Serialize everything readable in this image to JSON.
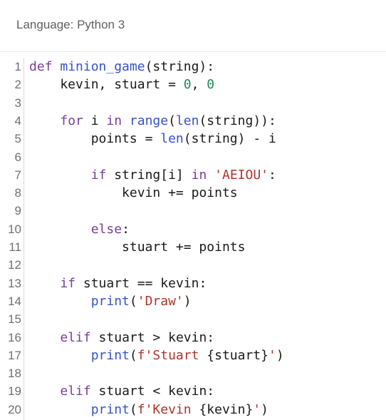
{
  "header": {
    "language_label": "Language: Python 3"
  },
  "editor": {
    "lines": [
      {
        "n": "1",
        "tokens": [
          {
            "t": "def",
            "c": "kw"
          },
          {
            "t": " ",
            "c": "txt"
          },
          {
            "t": "minion_game",
            "c": "fn"
          },
          {
            "t": "(string):",
            "c": "txt"
          }
        ]
      },
      {
        "n": "2",
        "tokens": [
          {
            "t": "    kevin, stuart ",
            "c": "txt"
          },
          {
            "t": "=",
            "c": "op"
          },
          {
            "t": " ",
            "c": "txt"
          },
          {
            "t": "0",
            "c": "num"
          },
          {
            "t": ", ",
            "c": "txt"
          },
          {
            "t": "0",
            "c": "num"
          }
        ]
      },
      {
        "n": "3",
        "tokens": []
      },
      {
        "n": "4",
        "tokens": [
          {
            "t": "    ",
            "c": "txt"
          },
          {
            "t": "for",
            "c": "kw"
          },
          {
            "t": " i ",
            "c": "txt"
          },
          {
            "t": "in",
            "c": "kw"
          },
          {
            "t": " ",
            "c": "txt"
          },
          {
            "t": "range",
            "c": "bi"
          },
          {
            "t": "(",
            "c": "txt"
          },
          {
            "t": "len",
            "c": "bi"
          },
          {
            "t": "(string)):",
            "c": "txt"
          }
        ]
      },
      {
        "n": "5",
        "tokens": [
          {
            "t": "        points ",
            "c": "txt"
          },
          {
            "t": "=",
            "c": "op"
          },
          {
            "t": " ",
            "c": "txt"
          },
          {
            "t": "len",
            "c": "bi"
          },
          {
            "t": "(string) ",
            "c": "txt"
          },
          {
            "t": "-",
            "c": "op"
          },
          {
            "t": " i",
            "c": "txt"
          }
        ]
      },
      {
        "n": "6",
        "tokens": []
      },
      {
        "n": "7",
        "tokens": [
          {
            "t": "        ",
            "c": "txt"
          },
          {
            "t": "if",
            "c": "kw"
          },
          {
            "t": " string[i] ",
            "c": "txt"
          },
          {
            "t": "in",
            "c": "kw"
          },
          {
            "t": " ",
            "c": "txt"
          },
          {
            "t": "'AEIOU'",
            "c": "str"
          },
          {
            "t": ":",
            "c": "txt"
          }
        ]
      },
      {
        "n": "8",
        "tokens": [
          {
            "t": "            kevin ",
            "c": "txt"
          },
          {
            "t": "+=",
            "c": "op"
          },
          {
            "t": " points",
            "c": "txt"
          }
        ]
      },
      {
        "n": "9",
        "tokens": []
      },
      {
        "n": "10",
        "tokens": [
          {
            "t": "        ",
            "c": "txt"
          },
          {
            "t": "else",
            "c": "kw"
          },
          {
            "t": ":",
            "c": "txt"
          }
        ]
      },
      {
        "n": "11",
        "tokens": [
          {
            "t": "            stuart ",
            "c": "txt"
          },
          {
            "t": "+=",
            "c": "op"
          },
          {
            "t": " points",
            "c": "txt"
          }
        ]
      },
      {
        "n": "12",
        "tokens": []
      },
      {
        "n": "13",
        "tokens": [
          {
            "t": "    ",
            "c": "txt"
          },
          {
            "t": "if",
            "c": "kw"
          },
          {
            "t": " stuart ",
            "c": "txt"
          },
          {
            "t": "==",
            "c": "op"
          },
          {
            "t": " kevin:",
            "c": "txt"
          }
        ]
      },
      {
        "n": "14",
        "tokens": [
          {
            "t": "        ",
            "c": "txt"
          },
          {
            "t": "print",
            "c": "bi"
          },
          {
            "t": "(",
            "c": "txt"
          },
          {
            "t": "'Draw'",
            "c": "str"
          },
          {
            "t": ")",
            "c": "txt"
          }
        ]
      },
      {
        "n": "15",
        "tokens": []
      },
      {
        "n": "16",
        "tokens": [
          {
            "t": "    ",
            "c": "txt"
          },
          {
            "t": "elif",
            "c": "kw"
          },
          {
            "t": " stuart ",
            "c": "txt"
          },
          {
            "t": ">",
            "c": "op"
          },
          {
            "t": " kevin:",
            "c": "txt"
          }
        ]
      },
      {
        "n": "17",
        "tokens": [
          {
            "t": "        ",
            "c": "txt"
          },
          {
            "t": "print",
            "c": "bi"
          },
          {
            "t": "(",
            "c": "txt"
          },
          {
            "t": "f'Stuart ",
            "c": "str"
          },
          {
            "t": "{stuart}",
            "c": "txt"
          },
          {
            "t": "'",
            "c": "str"
          },
          {
            "t": ")",
            "c": "txt"
          }
        ]
      },
      {
        "n": "18",
        "tokens": []
      },
      {
        "n": "19",
        "tokens": [
          {
            "t": "    ",
            "c": "txt"
          },
          {
            "t": "elif",
            "c": "kw"
          },
          {
            "t": " stuart ",
            "c": "txt"
          },
          {
            "t": "<",
            "c": "op"
          },
          {
            "t": " kevin:",
            "c": "txt"
          }
        ]
      },
      {
        "n": "20",
        "tokens": [
          {
            "t": "        ",
            "c": "txt"
          },
          {
            "t": "print",
            "c": "bi"
          },
          {
            "t": "(",
            "c": "txt"
          },
          {
            "t": "f'Kevin ",
            "c": "str"
          },
          {
            "t": "{kevin}",
            "c": "txt"
          },
          {
            "t": "'",
            "c": "str"
          },
          {
            "t": ")",
            "c": "txt"
          }
        ]
      }
    ]
  },
  "colors": {
    "keyword": "#7a3e9d",
    "function": "#3553c9",
    "number": "#1f8a5a",
    "string": "#b0342b",
    "text": "#1a1a1a",
    "line_number": "#707070"
  }
}
